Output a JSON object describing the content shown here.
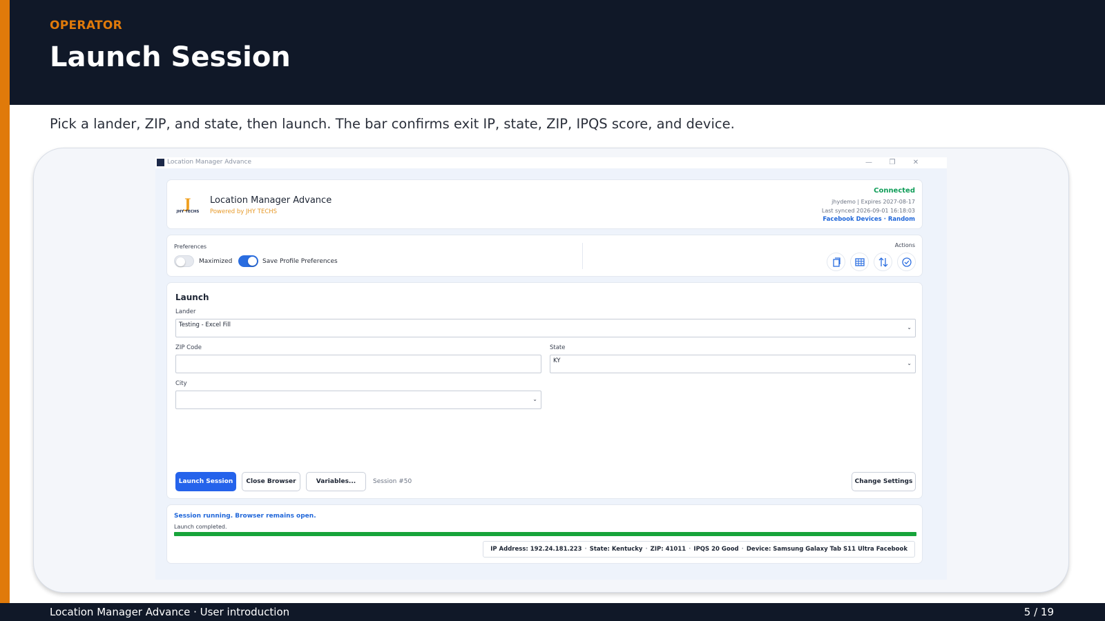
{
  "slide": {
    "section": "OPERATOR",
    "title": "Launch Session",
    "subtitle": "Pick a lander, ZIP, and state, then launch. The bar confirms exit IP, state, ZIP, IPQS score, and device.",
    "footer_left": "Location Manager Advance · User introduction",
    "footer_right": "5 / 19",
    "accent_color": "#e07a0a",
    "header_bg": "#101828"
  },
  "window": {
    "title": "Location Manager Advance",
    "minimize_glyph": "—",
    "restore_glyph": "❐",
    "close_glyph": "✕"
  },
  "header": {
    "logo_mark": "J",
    "logo_text": "JHY TECHS",
    "app_name": "Location Manager Advance",
    "powered_by": "Powered by JHY TECHS",
    "status": "Connected",
    "account": "jhydemo | Expires 2027-08-17",
    "last_synced": "Last synced 2026-09-01 16:18:03",
    "links": "Facebook Devices · Random"
  },
  "preferences": {
    "label": "Preferences",
    "maximized": {
      "label": "Maximized",
      "on": false
    },
    "save_profile": {
      "label": "Save Profile Preferences",
      "on": true
    },
    "actions_label": "Actions",
    "action_icons": [
      "copy-icon",
      "grid-icon",
      "sort-arrows-icon",
      "check-circle-icon"
    ]
  },
  "launch": {
    "title": "Launch",
    "lander_label": "Lander",
    "lander_value": "Testing - Excel Fill",
    "zip_label": "ZIP Code",
    "zip_value": "",
    "state_label": "State",
    "state_value": "KY",
    "city_label": "City",
    "city_value": "",
    "launch_button": "Launch Session",
    "close_button": "Close Browser",
    "variables_button": "Variables...",
    "session_id": "Session #50",
    "change_settings_button": "Change Settings"
  },
  "status": {
    "running": "Session running. Browser remains open.",
    "message": "Launch completed.",
    "progress": 1.0,
    "progress_color": "#17a43a",
    "ip": "IP Address: 192.24.181.223",
    "state": "State: Kentucky",
    "zip": "ZIP: 41011",
    "ipqs": "IPQS 20 Good",
    "device": "Device: Samsung Galaxy Tab S11 Ultra Facebook",
    "separator": "·"
  }
}
